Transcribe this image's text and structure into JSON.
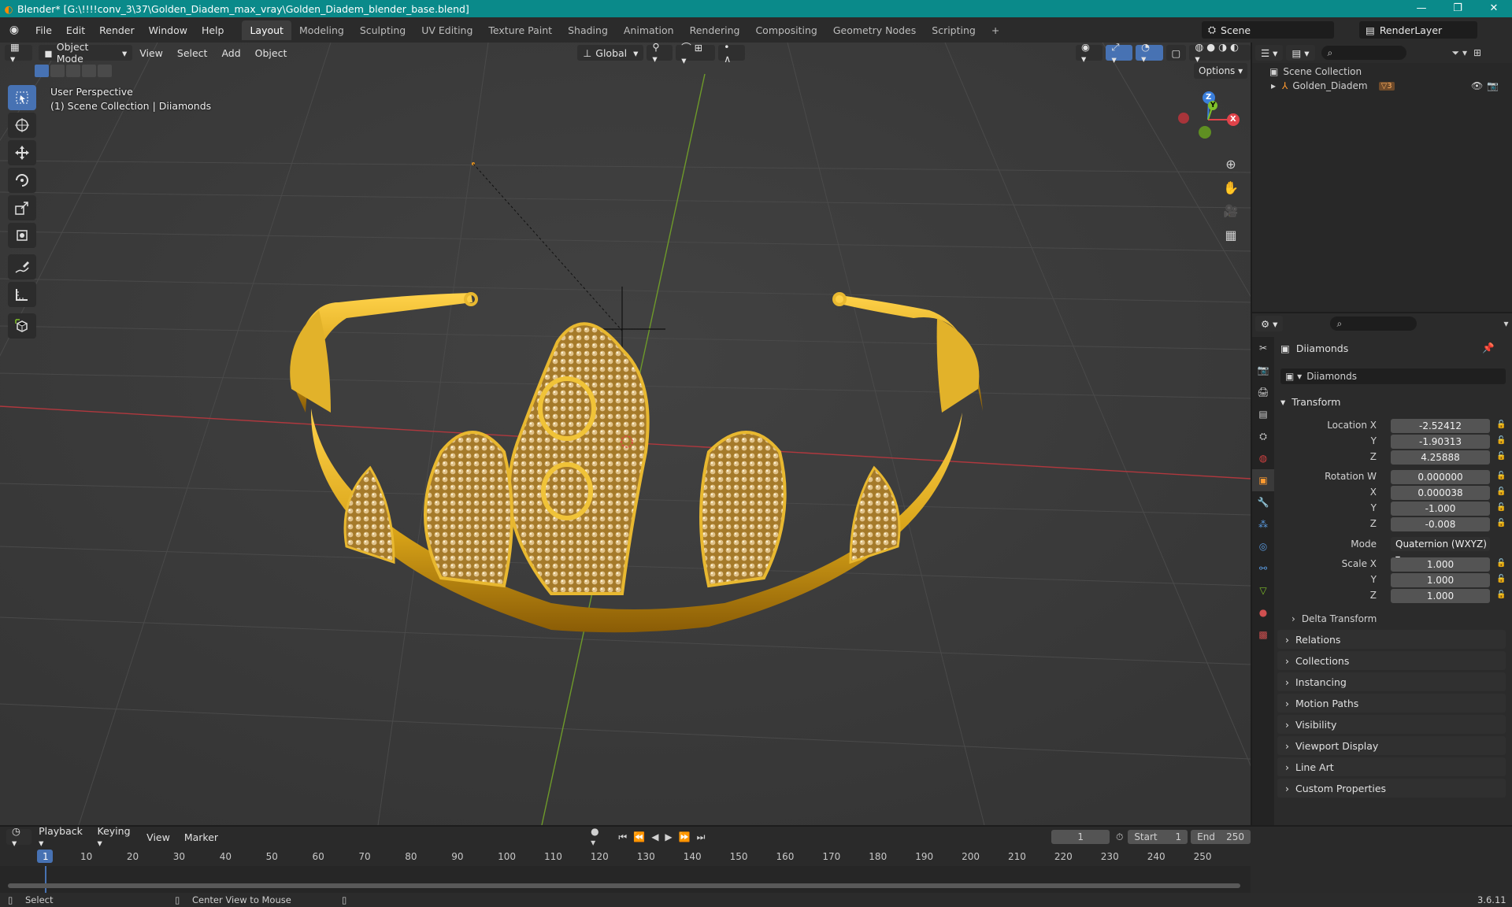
{
  "window": {
    "title": "Blender* [G:\\!!!!conv_3\\37\\Golden_Diadem_max_vray\\Golden_Diadem_blender_base.blend]",
    "controls": [
      "—",
      "❐",
      "✕"
    ]
  },
  "menu": {
    "items": [
      "File",
      "Edit",
      "Render",
      "Window",
      "Help"
    ],
    "workspaces": [
      "Layout",
      "Modeling",
      "Sculpting",
      "UV Editing",
      "Texture Paint",
      "Shading",
      "Animation",
      "Rendering",
      "Compositing",
      "Geometry Nodes",
      "Scripting"
    ],
    "active_workspace": "Layout",
    "add_workspace": "+",
    "scene": "Scene",
    "view_layer": "RenderLayer"
  },
  "viewport": {
    "mode": "Object Mode",
    "menus": [
      "View",
      "Select",
      "Add",
      "Object"
    ],
    "orientation": "Global",
    "options_label": "Options",
    "info_line1": "User Perspective",
    "info_line2": "(1) Scene Collection | Diiamonds",
    "gizmo": {
      "z": "Z",
      "y": "Y",
      "x": "X"
    }
  },
  "outliner": {
    "root": "Scene Collection",
    "items": [
      {
        "name": "Golden_Diadem",
        "count": "3"
      }
    ]
  },
  "properties": {
    "object_name": "Diiamonds",
    "data_name": "Diiamonds",
    "transform_label": "Transform",
    "location": {
      "label_x": "Location X",
      "label_y": "Y",
      "label_z": "Z",
      "x": "-2.52412",
      "y": "-1.90313",
      "z": "4.25888"
    },
    "rotation": {
      "label_w": "Rotation W",
      "label_x": "X",
      "label_y": "Y",
      "label_z": "Z",
      "w": "0.000000",
      "x": "0.000038",
      "y": "-1.000",
      "z": "-0.008"
    },
    "mode_label": "Mode",
    "mode_value": "Quaternion (WXYZ)",
    "scale": {
      "label_x": "Scale X",
      "label_y": "Y",
      "label_z": "Z",
      "x": "1.000",
      "y": "1.000",
      "z": "1.000"
    },
    "delta_transform": "Delta Transform",
    "sections": [
      "Relations",
      "Collections",
      "Instancing",
      "Motion Paths",
      "Visibility",
      "Viewport Display",
      "Line Art",
      "Custom Properties"
    ]
  },
  "timeline": {
    "menus": [
      "Playback",
      "Keying",
      "View",
      "Marker"
    ],
    "current_frame": "1",
    "start_label": "Start",
    "start": "1",
    "end_label": "End",
    "end": "250",
    "ruler": [
      "1",
      "10",
      "20",
      "30",
      "40",
      "50",
      "60",
      "70",
      "80",
      "90",
      "100",
      "110",
      "120",
      "130",
      "140",
      "150",
      "160",
      "170",
      "180",
      "190",
      "200",
      "210",
      "220",
      "230",
      "240",
      "250"
    ]
  },
  "status": {
    "left": "Select",
    "middle": "Center View to Mouse",
    "version": "3.6.11"
  },
  "colors": {
    "accent": "#4772b3",
    "gold": "#d9a418",
    "x_axis": "#e0434a",
    "y_axis": "#7fbf2a",
    "z_axis": "#3b7fdc"
  }
}
